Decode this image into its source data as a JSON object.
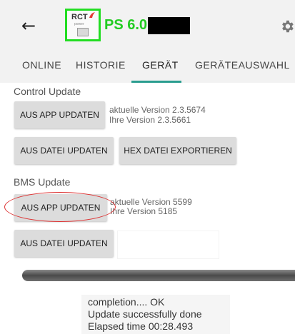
{
  "appbar": {
    "back_glyph": "←",
    "logo_text": "RCT",
    "logo_sub": "power",
    "title": "PS 6.0",
    "settings_icon": "gear-icon"
  },
  "tabs": [
    {
      "label": "ONLINE",
      "active": false
    },
    {
      "label": "HISTORIE",
      "active": false
    },
    {
      "label": "GERÄT",
      "active": true
    },
    {
      "label": "GERÄTEAUSWAHL",
      "active": false
    }
  ],
  "control_update": {
    "section_label": "Control Update",
    "app_update_button": "AUS APP UPDATEN",
    "current_version": "aktuelle Version 2.3.5674",
    "your_version": "Ihre Version 2.3.5661",
    "file_update_button": "AUS DATEI UPDATEN",
    "hex_export_button": "HEX DATEI EXPORTIEREN"
  },
  "bms_update": {
    "section_label": "BMS Update",
    "app_update_button": "AUS APP UPDATEN",
    "current_version": "aktuelle Version 5599",
    "your_version": "Ihre Version 5185",
    "file_update_button": "AUS DATEI UPDATEN"
  },
  "progress": {
    "fraction": 1.0
  },
  "status_log": [
    "completion.... OK",
    "Update successfully done",
    "Elapsed time 00:28.493"
  ],
  "colors": {
    "accent_green": "#22cc22",
    "tab_indicator": "#2a9d8f",
    "annotation_red": "#dd3333"
  }
}
